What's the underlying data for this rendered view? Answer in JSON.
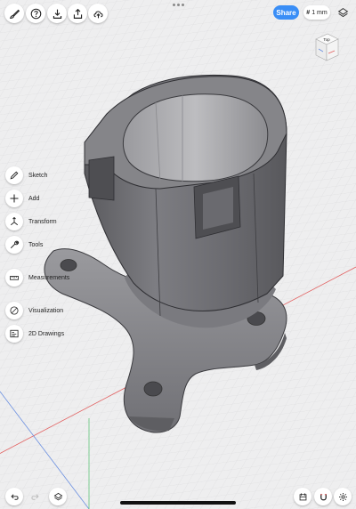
{
  "toolbar": {
    "share_label": "Share",
    "grid_hash": "#",
    "grid_value": "1 mm",
    "left_icons": [
      "paintbrush-icon",
      "help-icon",
      "import-icon",
      "export-icon",
      "cloud-upload-icon"
    ]
  },
  "viewcube": {
    "face_label": "Top"
  },
  "side_menu": {
    "items": [
      {
        "label": "Sketch",
        "icon": "pencil-icon"
      },
      {
        "label": "Add",
        "icon": "plus-icon"
      },
      {
        "label": "Transform",
        "icon": "move-arrows-icon"
      },
      {
        "label": "Tools",
        "icon": "wrench-icon"
      },
      {
        "label": "Measurements",
        "icon": "ruler-icon"
      },
      {
        "label": "Visualization",
        "icon": "eye-icon"
      },
      {
        "label": "2D Drawings",
        "icon": "drawing-icon"
      }
    ]
  },
  "bottom_bar": {
    "left": [
      "undo-icon",
      "redo-icon",
      "layers-icon"
    ],
    "right": [
      "history-icon",
      "magnet-icon",
      "settings-icon"
    ]
  },
  "colors": {
    "accent": "#3a8ef6",
    "background": "#eeeeef",
    "model": "#6f6f73",
    "axis_red": "#e26060",
    "axis_green": "#5fc47a",
    "axis_blue": "#6a8fe0"
  }
}
